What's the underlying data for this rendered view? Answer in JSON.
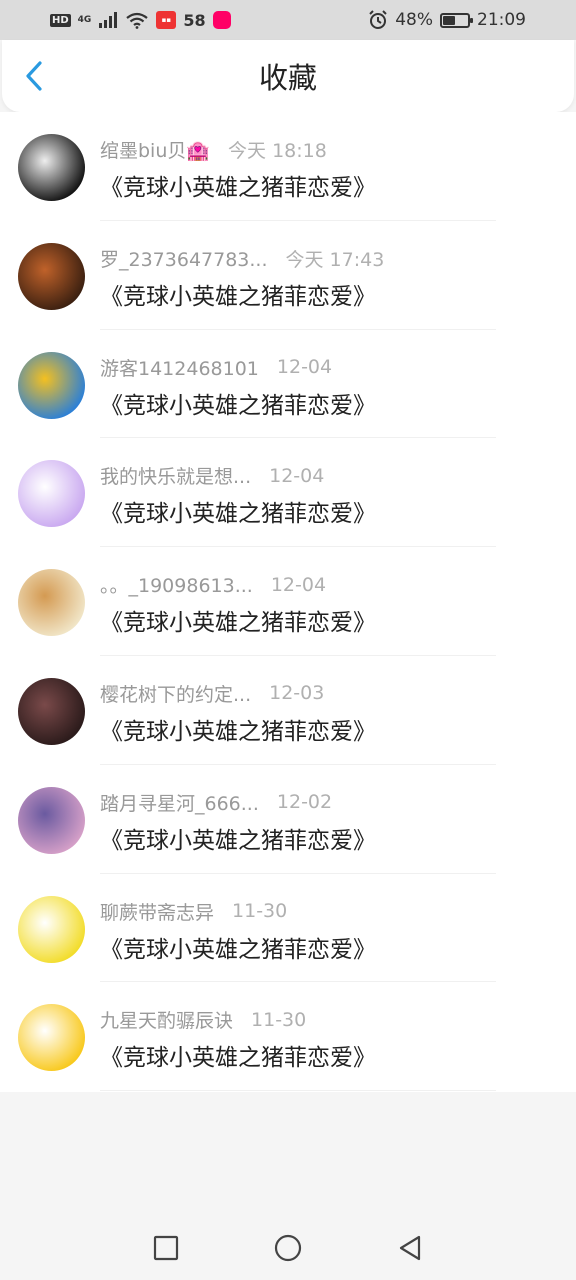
{
  "status_bar": {
    "hd": "HD",
    "network": "4G",
    "app2": "58",
    "battery": "48%",
    "battery_level": 0.48,
    "time": "21:09"
  },
  "header": {
    "title": "收藏"
  },
  "items": [
    {
      "user": "绾墨biu贝🏩",
      "time": "今天 18:18",
      "title": "《竞球小英雄之猪菲恋爱》",
      "avatar_colors": [
        "#111",
        "#eee"
      ]
    },
    {
      "user": "罗_2373647783...",
      "time": "今天 17:43",
      "title": "《竞球小英雄之猪菲恋爱》",
      "avatar_colors": [
        "#3a1f10",
        "#c0622a"
      ]
    },
    {
      "user": "游客1412468101",
      "time": "12-04",
      "title": "《竞球小英雄之猪菲恋爱》",
      "avatar_colors": [
        "#2a7fd8",
        "#f4c020"
      ]
    },
    {
      "user": "我的快乐就是想...",
      "time": "12-04",
      "title": "《竞球小英雄之猪菲恋爱》",
      "avatar_colors": [
        "#c9a8f0",
        "#ffffff"
      ]
    },
    {
      "user": "。。_19098613...",
      "time": "12-04",
      "title": "《竞球小英雄之猪菲恋爱》",
      "avatar_colors": [
        "#f1e6c8",
        "#d49a52"
      ]
    },
    {
      "user": "樱花树下的约定...",
      "time": "12-03",
      "title": "《竞球小英雄之猪菲恋爱》",
      "avatar_colors": [
        "#2a1a1a",
        "#7a4a4a"
      ]
    },
    {
      "user": "踏月寻星河_666...",
      "time": "12-02",
      "title": "《竞球小英雄之猪菲恋爱》",
      "avatar_colors": [
        "#d6a0c8",
        "#6a5aa0"
      ]
    },
    {
      "user": "聊蕨带斋志异",
      "time": "11-30",
      "title": "《竞球小英雄之猪菲恋爱》",
      "avatar_colors": [
        "#f2dc28",
        "#ffffff"
      ]
    },
    {
      "user": "九星天酌骣辰诀",
      "time": "11-30",
      "title": "《竞球小英雄之猪菲恋爱》",
      "avatar_colors": [
        "#f8c81a",
        "#ffffff"
      ]
    }
  ],
  "colors": {
    "accent": "#2a9ae0",
    "meta_text": "#999999",
    "title_text": "#222222"
  },
  "nav": {
    "icons": [
      "square-recents-icon",
      "circle-home-icon",
      "triangle-back-icon"
    ]
  }
}
